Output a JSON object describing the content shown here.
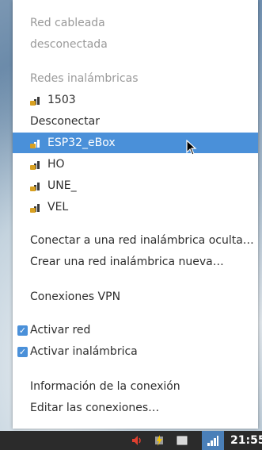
{
  "menu": {
    "wired_header": "Red cableada",
    "wired_status": "desconectada",
    "wireless_header": "Redes inalámbricas",
    "connected_network": "1503",
    "disconnect": "Desconectar",
    "networks": [
      {
        "name": "ESP32_eBox"
      },
      {
        "name": "HO"
      },
      {
        "name": "UNE_"
      },
      {
        "name": "VEL"
      }
    ],
    "connect_hidden": "Conectar a una red inalámbrica oculta…",
    "create_new": "Crear una red inalámbrica nueva…",
    "vpn": "Conexiones VPN",
    "enable_network": "Activar red",
    "enable_wireless": "Activar inalámbrica",
    "connection_info": "Información de la conexión",
    "edit_connections": "Editar las conexiones…"
  },
  "taskbar": {
    "clock": "21:55"
  },
  "colors": {
    "highlight": "#4a90d9",
    "menu_bg": "#ffffff",
    "disabled_text": "#9a9a9a",
    "taskbar_bg": "#2b2b2b"
  }
}
